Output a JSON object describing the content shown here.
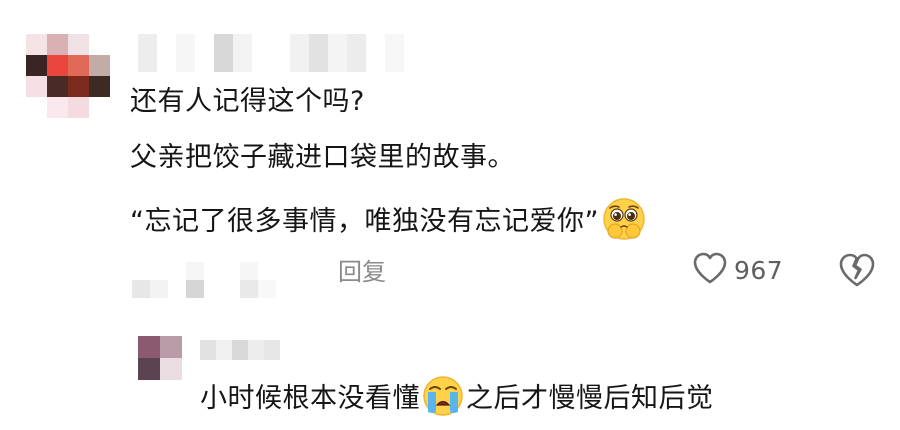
{
  "comment": {
    "lines": [
      "还有人记得这个吗?",
      "父亲把饺子藏进口袋里的故事。",
      "“忘记了很多事情，唯独没有忘记爱你”"
    ],
    "emoji_icon": "pleading-face-icon",
    "reply_label": "回复",
    "like_count": "967",
    "like_icon": "heart-outline-icon",
    "dislike_icon": "broken-heart-icon"
  },
  "reply": {
    "text_before": "小时候根本没看懂",
    "emoji_icon": "loudly-crying-face-icon",
    "text_after": "之后才慢慢后知后觉"
  },
  "colors": {
    "text": "#161616",
    "meta_text": "#8a8a8a",
    "like_count": "#5f5f5f"
  }
}
